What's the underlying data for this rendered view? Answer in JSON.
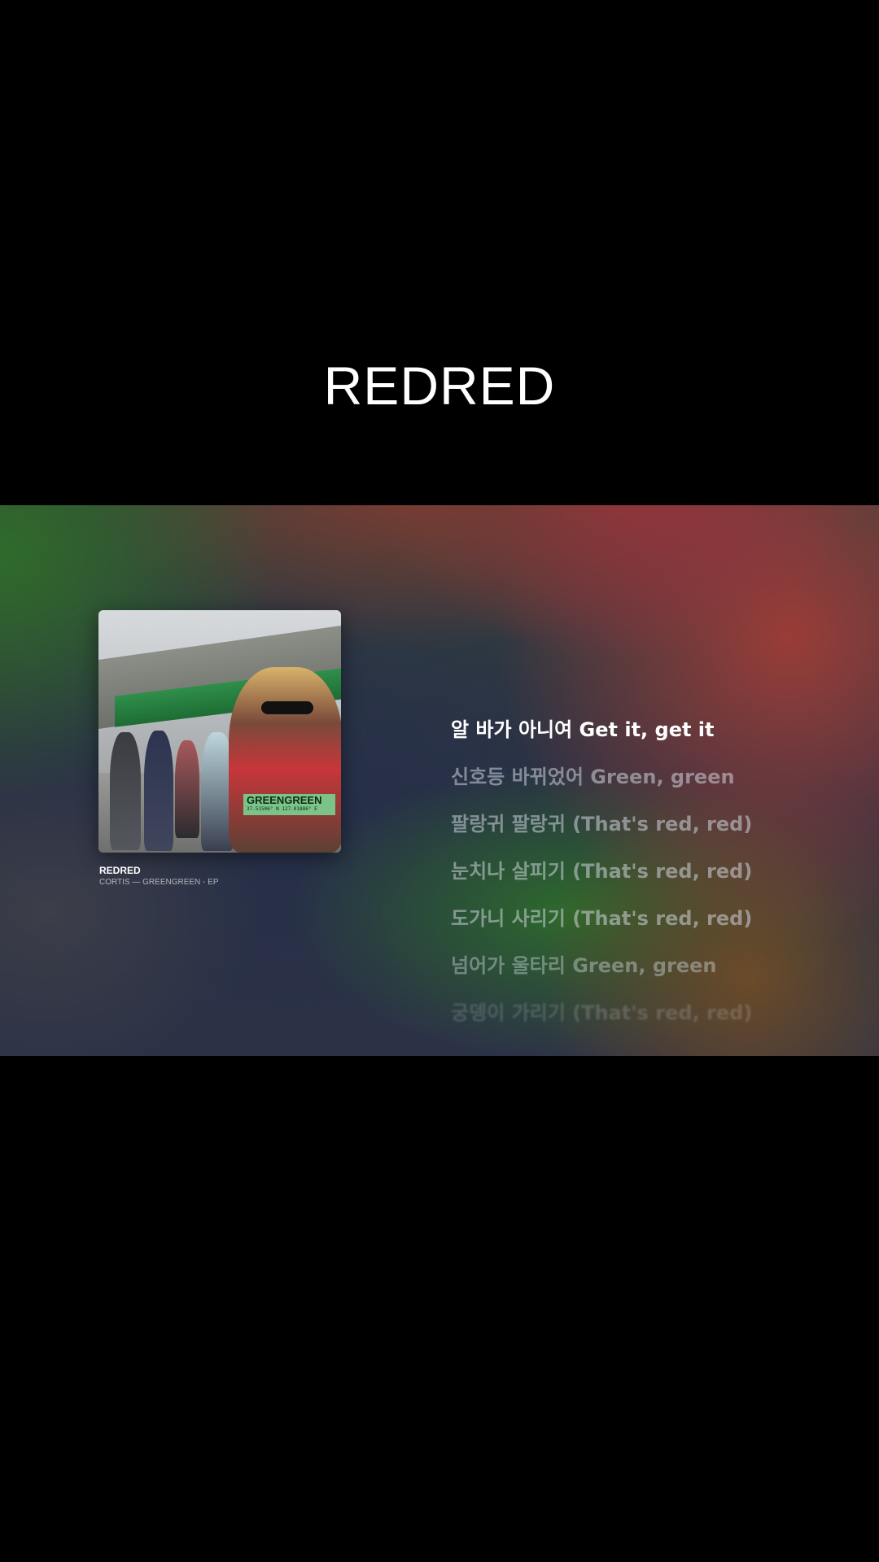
{
  "video_title": "REDRED",
  "player": {
    "album_label": {
      "name": "GREENGREEN",
      "coords": "37.51506° N  127.01886° E"
    },
    "track": {
      "title": "REDRED",
      "subtitle": "CORTIS — GREENGREEN - EP"
    },
    "lyrics": [
      "알 바가 아니여 Get it, get it",
      "신호등 바뀌었어 Green, green",
      "팔랑귀 팔랑귀 (That's red, red)",
      "눈치나 살피기 (That's red, red)",
      "도가니 사리기 (That's red, red)",
      "넘어가 울타리 Green, green",
      "궁뎅이 가리기 (That's red, red)"
    ],
    "active_lyric_index": 0
  }
}
